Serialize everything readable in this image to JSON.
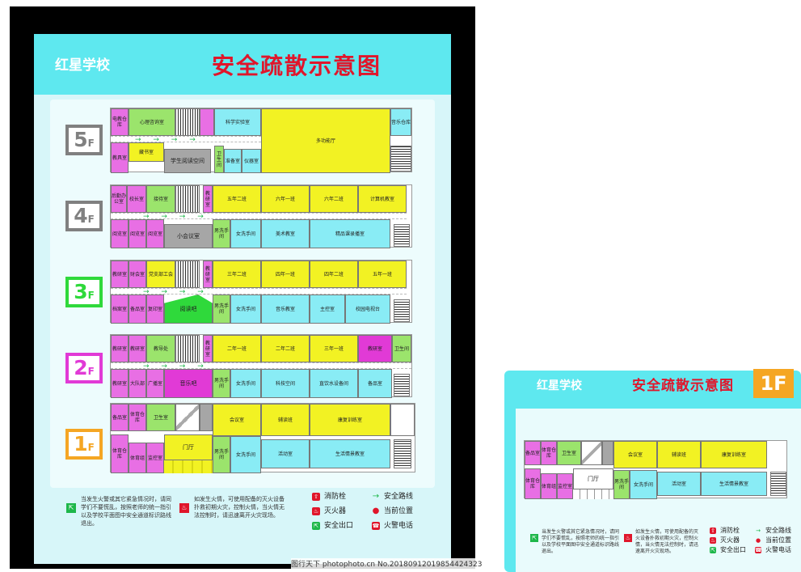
{
  "poster": {
    "school": "红星学校",
    "title": "安全疏散示意图"
  },
  "floors": [
    {
      "label": "5",
      "rooms": {
        "r1": "电教仓库",
        "r2": "心理咨询室",
        "r3": "教具室",
        "r4": "藏书室",
        "r5": "科学实验室",
        "r6": "多功能厅",
        "r7": "音乐仓库",
        "r8": "学生阅读空间",
        "r9": "卫生间",
        "r10": "准备室",
        "r11": "仪器室"
      }
    },
    {
      "label": "4",
      "rooms": {
        "r1": "后勤办公室",
        "r2": "校长室",
        "r3": "接待室",
        "r4": "教研室",
        "r5": "五年二班",
        "r6": "六年一班",
        "r7": "六年二班",
        "r8": "计算机教室",
        "r9": "阅览室",
        "r10": "阅览室",
        "r11": "阅览室",
        "r12": "小会议室",
        "r13": "男洗手间",
        "r14": "女洗手间",
        "r15": "美术教室",
        "r16": "精品课录播室"
      }
    },
    {
      "label": "3",
      "rooms": {
        "r1": "教研室",
        "r2": "财会室",
        "r3": "党支部工会",
        "r4": "教研室",
        "r5": "三年二班",
        "r6": "四年一班",
        "r7": "四年二班",
        "r8": "五年一班",
        "r9": "档案室",
        "r10": "备品室",
        "r11": "复印室",
        "r12": "阅读吧",
        "r13": "男洗手间",
        "r14": "女洗手间",
        "r15": "音乐教室",
        "r16": "主控室",
        "r17": "校园电视台"
      }
    },
    {
      "label": "2",
      "rooms": {
        "r1": "教研室",
        "r2": "教研室",
        "r3": "教导处",
        "r4": "教研室",
        "r5": "二年一班",
        "r6": "二年二班",
        "r7": "三年一班",
        "r8": "教研室",
        "r9": "卫生间",
        "r10": "教研室",
        "r11": "大队部",
        "r12": "广播室",
        "r13": "音乐吧",
        "r14": "男洗手间",
        "r15": "女洗手间",
        "r16": "科技空间",
        "r17": "直饮水设备间",
        "r18": "备品室"
      }
    },
    {
      "label": "1",
      "rooms": {
        "r1": "备品室",
        "r2": "体育仓库",
        "r3": "卫生室",
        "r4": "会议室",
        "r5": "辅读班",
        "r6": "康复训练室",
        "r7": "体育仓库",
        "r8": "体育组",
        "r9": "监控室",
        "r10": "门厅",
        "r11": "男洗手间",
        "r12": "女洗手间",
        "r13": "活动室",
        "r14": "生活情景教室"
      }
    }
  ],
  "notes": {
    "n1": "当发生火警或其它紧急情况时，请同学们不要慌乱，按照老师的统一指引以及学校平面图中安全通道标识路线退出。",
    "n2": "如发生火情，可使用配备的灭火设备扑救初期火灾，控制火情，当火情无法控制时，请迅速离开火灾现场。"
  },
  "legend": {
    "l1": "消防栓",
    "l2": "灭火器",
    "l3": "安全出口",
    "l4": "安全路线",
    "l5": "当前位置",
    "l6": "火警电话"
  },
  "arrow_text": "→ → → →",
  "poster2": {
    "school": "红星学校",
    "title": "安全疏散示意图",
    "floor": "1F"
  },
  "watermark": "图行天下 photophoto.cn No.20180912019854424323",
  "colors": {
    "accent": "#5ee8ef",
    "title": "#e0162b",
    "badge5": "#808080",
    "badge4": "#808080",
    "badge3": "#2fd93b",
    "badge2": "#e13ad6",
    "badge1": "#f5a623"
  }
}
